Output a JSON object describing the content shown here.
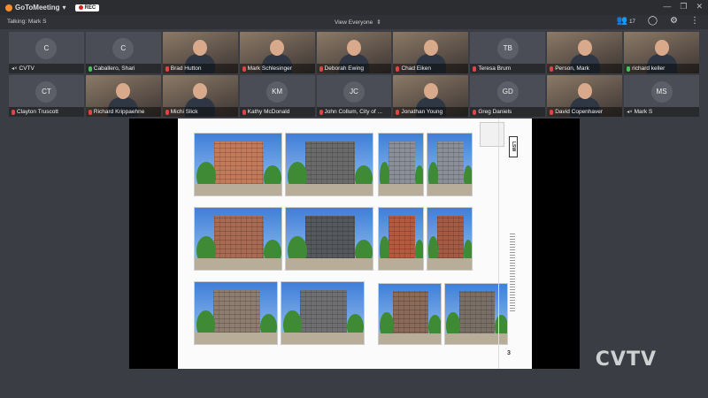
{
  "titlebar": {
    "app_name": "GoToMeeting",
    "rec_label": "REC",
    "minimize": "—",
    "restore": "❐",
    "close": "✕"
  },
  "toolbar": {
    "talking": "Talking: Mark S",
    "view_label": "View Everyone",
    "attendee_count": "17"
  },
  "participants": [
    {
      "name": "CVTV",
      "initials": "C",
      "video": false,
      "mic": "speaker"
    },
    {
      "name": "Caballero, Shari",
      "initials": "C",
      "video": false,
      "mic": "on"
    },
    {
      "name": "Brad Hutton",
      "initials": "",
      "video": true,
      "mic": "off"
    },
    {
      "name": "Mark Schlesinger",
      "initials": "",
      "video": true,
      "mic": "off"
    },
    {
      "name": "Deborah Ewing",
      "initials": "",
      "video": true,
      "mic": "off"
    },
    {
      "name": "Chad Eiken",
      "initials": "",
      "video": true,
      "mic": "off"
    },
    {
      "name": "Teresa Brum",
      "initials": "TB",
      "video": false,
      "mic": "off"
    },
    {
      "name": "Person, Mark",
      "initials": "",
      "video": true,
      "mic": "off"
    },
    {
      "name": "richard keller",
      "initials": "",
      "video": true,
      "mic": "on"
    },
    {
      "name": "Clayton Truscott",
      "initials": "CT",
      "video": false,
      "mic": "off"
    },
    {
      "name": "Richard Krippaehne",
      "initials": "",
      "video": true,
      "mic": "off"
    },
    {
      "name": "Michi Slick",
      "initials": "",
      "video": true,
      "mic": "off"
    },
    {
      "name": "Kathy McDonald",
      "initials": "KM",
      "video": false,
      "mic": "off"
    },
    {
      "name": "John Collum, City of ...",
      "initials": "JC",
      "video": false,
      "mic": "off"
    },
    {
      "name": "Jonathan Young",
      "initials": "",
      "video": true,
      "mic": "off"
    },
    {
      "name": "Greg Daniels",
      "initials": "GD",
      "video": false,
      "mic": "off"
    },
    {
      "name": "David Copenhaver",
      "initials": "",
      "video": true,
      "mic": "off"
    },
    {
      "name": "Mark S",
      "initials": "MS",
      "video": false,
      "mic": "speaker"
    }
  ],
  "shared_screen": {
    "sheet_logo": "LSW",
    "sheet_number": "3"
  },
  "watermark": "CVTV"
}
